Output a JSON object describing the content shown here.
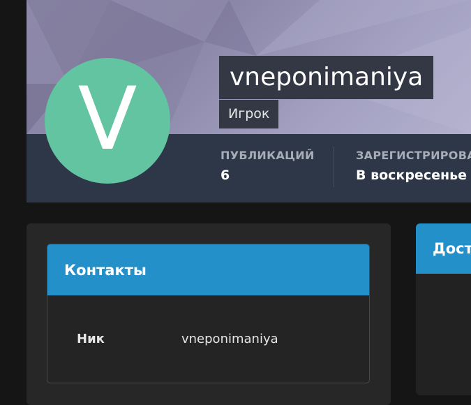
{
  "profile": {
    "avatar_letter": "V",
    "username": "vneponimaniya",
    "role": "Игрок"
  },
  "stats": [
    {
      "label": "ПУБЛИКАЦИЙ",
      "value": "6"
    },
    {
      "label": "ЗАРЕГИСТРИРОВА",
      "value": "В воскресенье в"
    }
  ],
  "contacts": {
    "title": "Контакты",
    "rows": [
      {
        "key": "Ник",
        "value": "vneponimaniya"
      }
    ]
  },
  "side_panel": {
    "title": "Дост"
  },
  "colors": {
    "accent": "#2390c9",
    "avatar": "#63c4a1",
    "cover_bar": "#2e3747"
  }
}
